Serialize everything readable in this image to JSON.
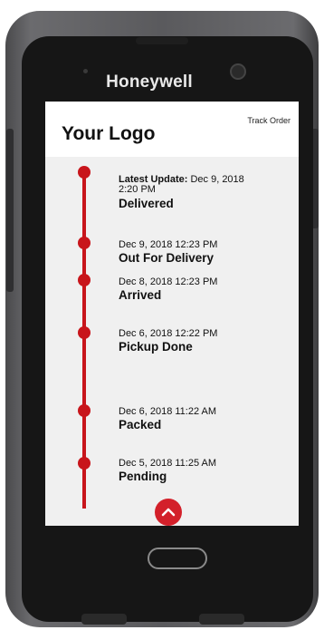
{
  "device": {
    "brand": "Honeywell"
  },
  "header": {
    "logo": "Your Logo",
    "track_order": "Track Order"
  },
  "timeline": {
    "accent_color": "#c8151b",
    "latest": {
      "label": "Latest Update:",
      "date_line1": "Dec 9, 2018",
      "date_line2": "2:20 PM",
      "status": "Delivered"
    },
    "events": [
      {
        "date": "Dec 9, 2018 12:23 PM",
        "status": "Out For Delivery"
      },
      {
        "date": "Dec 8, 2018 12:23 PM",
        "status": "Arrived"
      },
      {
        "date": "Dec 6, 2018 12:22 PM",
        "status": "Pickup Done"
      },
      {
        "date": "Dec 6, 2018 11:22 AM",
        "status": "Packed"
      },
      {
        "date": "Dec 5, 2018 11:25 AM",
        "status": "Pending"
      }
    ]
  },
  "scroll_up": {
    "icon": "chevron-up-icon"
  }
}
